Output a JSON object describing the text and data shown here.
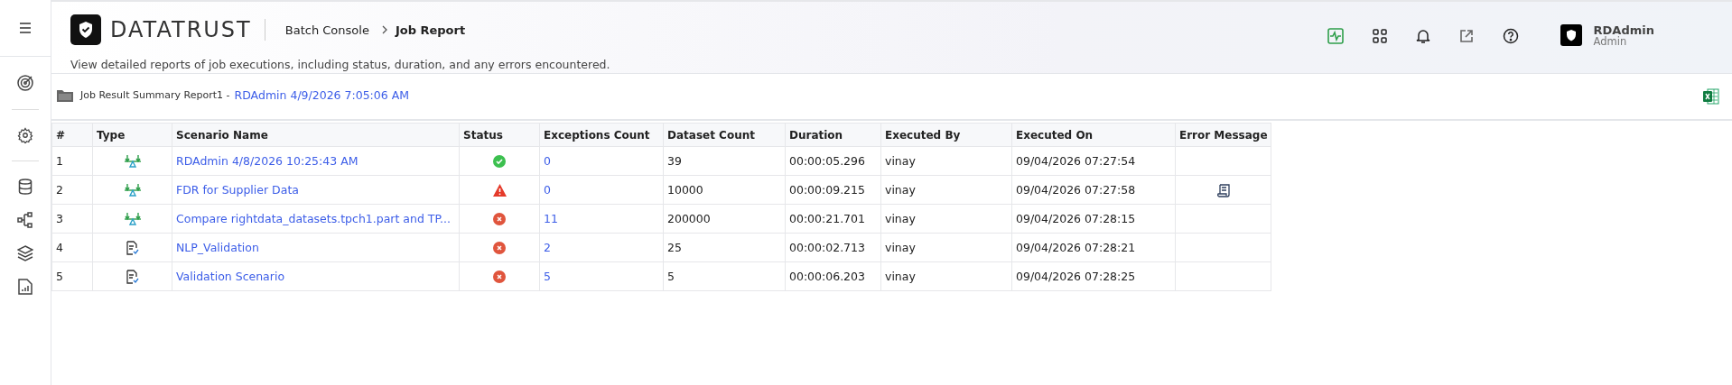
{
  "brand": {
    "name": "DATATRUST"
  },
  "breadcrumb": [
    {
      "label": "Batch Console",
      "current": false
    },
    {
      "label": "Job Report",
      "current": true
    }
  ],
  "description": "View detailed reports of job executions, including status, duration, and any errors encountered.",
  "user": {
    "name": "RDAdmin",
    "role": "Admin"
  },
  "report": {
    "title": "Job Result Summary Report1 -",
    "run": "RDAdmin 4/9/2026 7:05:06 AM"
  },
  "table": {
    "columns": [
      "#",
      "Type",
      "Scenario Name",
      "Status",
      "Exceptions Count",
      "Dataset Count",
      "Duration",
      "Executed By",
      "Executed On",
      "Error Message"
    ],
    "rows": [
      {
        "index": "1",
        "type_icon": {
          "kind": "compare"
        },
        "scenario": "RDAdmin 4/8/2026 10:25:43 AM",
        "status_icon": {
          "kind": "success"
        },
        "exceptions": "0",
        "datasets": "39",
        "duration": "00:00:05.296",
        "executed_by": "vinay",
        "executed_on": "09/04/2026 07:27:54",
        "error_log": false
      },
      {
        "index": "2",
        "type_icon": {
          "kind": "compare"
        },
        "scenario": "FDR for Supplier Data",
        "status_icon": {
          "kind": "warning"
        },
        "exceptions": "0",
        "datasets": "10000",
        "duration": "00:00:09.215",
        "executed_by": "vinay",
        "executed_on": "09/04/2026 07:27:58",
        "error_log": true
      },
      {
        "index": "3",
        "type_icon": {
          "kind": "compare"
        },
        "scenario": "Compare rightdata_datasets.tpch1.part and TP...",
        "status_icon": {
          "kind": "error"
        },
        "exceptions": "11",
        "datasets": "200000",
        "duration": "00:00:21.701",
        "executed_by": "vinay",
        "executed_on": "09/04/2026 07:28:15",
        "error_log": false
      },
      {
        "index": "4",
        "type_icon": {
          "kind": "validation"
        },
        "scenario": "NLP_Validation",
        "status_icon": {
          "kind": "error"
        },
        "exceptions": "2",
        "datasets": "25",
        "duration": "00:00:02.713",
        "executed_by": "vinay",
        "executed_on": "09/04/2026 07:28:21",
        "error_log": false
      },
      {
        "index": "5",
        "type_icon": {
          "kind": "validation"
        },
        "scenario": "Validation Scenario",
        "status_icon": {
          "kind": "error"
        },
        "exceptions": "5",
        "datasets": "5",
        "duration": "00:00:06.203",
        "executed_by": "vinay",
        "executed_on": "09/04/2026 07:28:25",
        "error_log": false
      }
    ]
  }
}
